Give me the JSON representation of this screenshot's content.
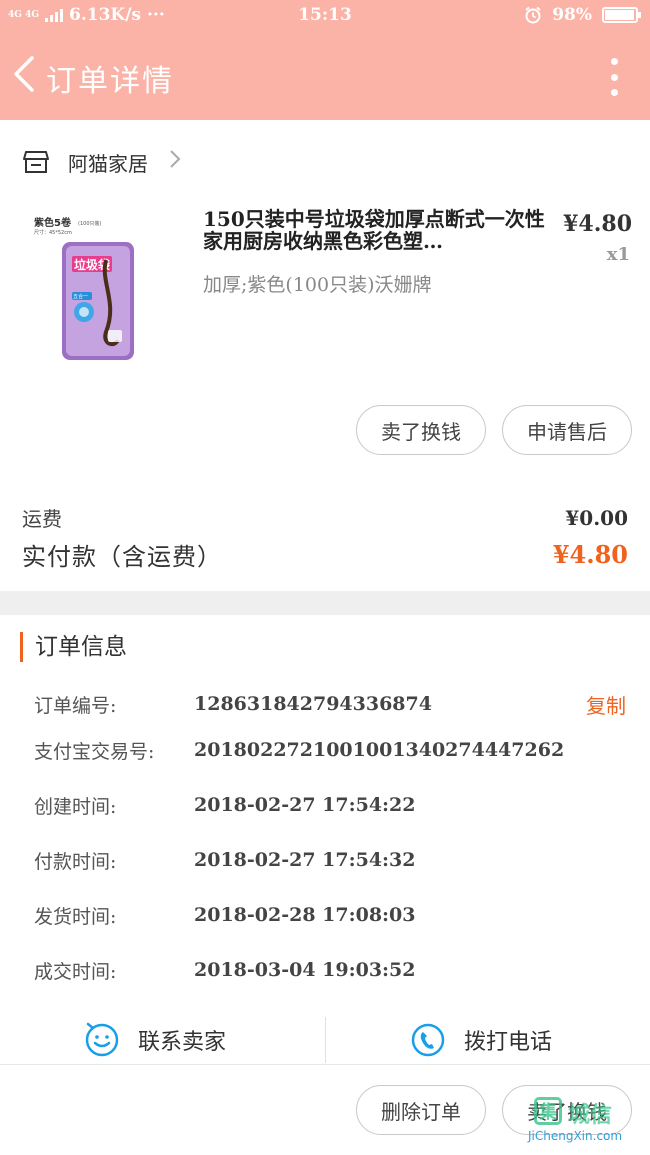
{
  "status_bar": {
    "network": "4G 4G",
    "speed": "6.13K/s",
    "dots": "···",
    "time": "15:13",
    "battery": "98%",
    "battery_level": 0.98
  },
  "nav": {
    "title": "订单详情"
  },
  "shop": {
    "name": "阿猫家居"
  },
  "product": {
    "title": "150只装中号垃圾袋加厚点断式一次性家用厨房收纳黑色彩色塑…",
    "spec": "加厚;紫色(100只装)沃姗牌",
    "price": "¥4.80",
    "qty": "x1",
    "image_text": {
      "top": "紫色5卷",
      "top_small": "(100只装)",
      "size": "尺寸：45*52cm",
      "brand": "垃圾袋",
      "badge": "五合一"
    }
  },
  "actions": {
    "sell_label": "卖了换钱",
    "after_sale_label": "申请售后"
  },
  "fees": {
    "shipping_label": "运费",
    "shipping_value": "¥0.00",
    "total_label": "实付款（含运费）",
    "total_value": "¥4.80"
  },
  "order_info": {
    "section_title": "订单信息",
    "copy_label": "复制",
    "rows": [
      {
        "label": "订单编号:",
        "value": "128631842794336874"
      },
      {
        "label": "支付宝交易号:",
        "value": "2018022721001001340274447262"
      },
      {
        "label": "创建时间:",
        "value": "2018-02-27 17:54:22"
      },
      {
        "label": "付款时间:",
        "value": "2018-02-27 17:54:32"
      },
      {
        "label": "发货时间:",
        "value": "2018-02-28 17:08:03"
      },
      {
        "label": "成交时间:",
        "value": "2018-03-04 19:03:52"
      }
    ]
  },
  "contact": {
    "seller_label": "联系卖家",
    "call_label": "拨打电话"
  },
  "bottom": {
    "delete_label": "删除订单",
    "sell_label": "卖了换钱"
  },
  "watermark": {
    "mark": "集",
    "text": "城信",
    "url": "JiChengXin.com"
  },
  "colors": {
    "header": "#fbb3a8",
    "accent": "#f0631e",
    "band": "#efefef",
    "icon_blue": "#1b9ee8"
  }
}
